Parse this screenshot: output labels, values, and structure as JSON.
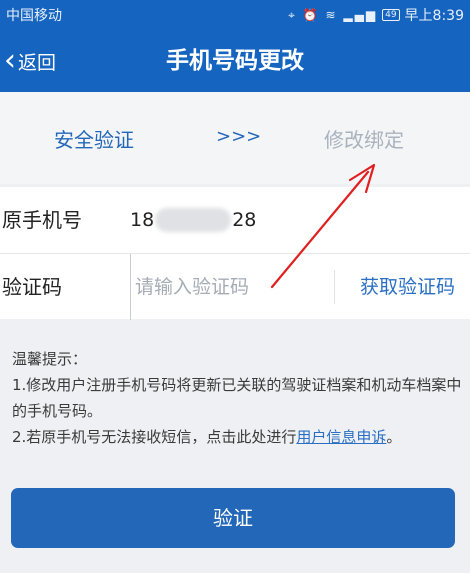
{
  "status_bar": {
    "carrier": "中国移动",
    "icons": [
      "location-icon",
      "alarm-icon",
      "wifi-icon",
      "signal-icon",
      "battery-icon"
    ],
    "battery": "49",
    "time": "早上8:39"
  },
  "nav": {
    "back_label": "返回",
    "title": "手机号码更改"
  },
  "steps": {
    "step1": "安全验证",
    "separator": ">>>",
    "step2": "修改绑定"
  },
  "form": {
    "phone_label": "原手机号",
    "phone_prefix": "18",
    "phone_suffix": "28",
    "code_label": "验证码",
    "code_value": "",
    "code_placeholder": "请输入验证码",
    "get_code_label": "获取验证码"
  },
  "tips": {
    "title": "温馨提示：",
    "line1": "1.修改用户注册手机号码将更新已关联的驾驶证档案和机动车档案中的手机号码。",
    "line2_prefix": "2.若原手机号无法接收短信，点击此处进行",
    "line2_link": "用户信息申诉",
    "line2_suffix": "。"
  },
  "verify_button": "验证",
  "colors": {
    "primary": "#1565c0",
    "button": "#2367b9",
    "link": "#2a6fc4",
    "inactive_step": "#a9b2bd",
    "annotation_arrow": "#e02020"
  }
}
